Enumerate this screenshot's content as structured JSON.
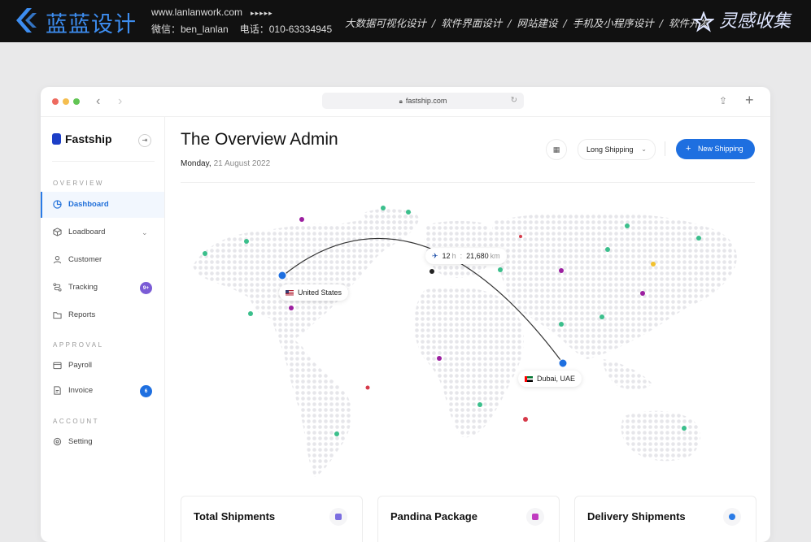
{
  "banner": {
    "brand": "蓝蓝设计",
    "website": "www.lanlanwork.com",
    "dots": "▸▸▸▸▸",
    "wechat": "微信：ben_lanlan",
    "phone": "电话：010-63334945",
    "services": [
      "大数据可视化设计",
      "软件界面设计",
      "网站建设",
      "手机及小程序设计",
      "软件开发"
    ],
    "separator": "/",
    "inspiration": "灵感收集"
  },
  "browser": {
    "url": "fastship.com",
    "back_icon": "chevron-left-icon",
    "forward_icon": "chevron-right-icon",
    "share_icon": "share-icon",
    "new_tab_icon": "plus-icon"
  },
  "sidebar": {
    "app_name": "Fastship",
    "sections": {
      "overview": "OVERVIEW",
      "approval": "APPROVAL",
      "account": "ACCOUNT"
    },
    "items": [
      {
        "label": "Dashboard",
        "icon": "chart-pie-icon",
        "active": true
      },
      {
        "label": "Loadboard",
        "icon": "box-icon",
        "has_chevron": true
      },
      {
        "label": "Customer",
        "icon": "user-icon"
      },
      {
        "label": "Tracking",
        "icon": "route-icon",
        "badge": "9+"
      },
      {
        "label": "Reports",
        "icon": "folder-icon"
      },
      {
        "label": "Payroll",
        "icon": "wallet-icon"
      },
      {
        "label": "Invoice",
        "icon": "document-icon",
        "badge": "6"
      },
      {
        "label": "Setting",
        "icon": "gear-icon"
      }
    ],
    "colors": {
      "accent": "#2a7be6",
      "badge_tracking": "#7b5cd6",
      "badge_invoice": "#1e6fe0"
    }
  },
  "main": {
    "title": "The Overview Admin",
    "date_day": "Monday,",
    "date_rest": "21 August 2022",
    "filter": "Long Shipping",
    "new_button": "New Shipping",
    "route": {
      "duration": "12",
      "duration_unit": "h",
      "separator": ":",
      "distance": "21,680",
      "distance_unit": "km",
      "origin": "United States",
      "destination": "Dubai, UAE"
    },
    "cards": [
      "Total Shipments",
      "Pandina Package",
      "Delivery Shipments"
    ]
  },
  "colors": {
    "primary": "#1e6fe0",
    "green_dot": "#3bbf8c",
    "purple_dot": "#9c1fa0",
    "red_dot": "#d63a4a",
    "yellow_dot": "#f2c12e"
  }
}
